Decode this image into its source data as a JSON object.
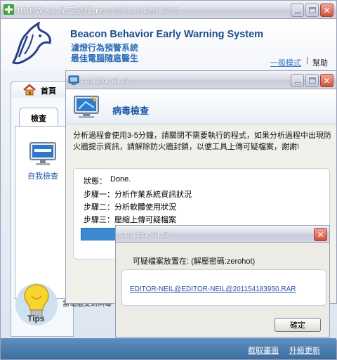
{
  "main_window": {
    "title": "BBEW v1.5 正式版 rev: 201104251625",
    "app_name": "Beacon Behavior Early Warning System",
    "slogan_line1": "濾燈行為預警系統",
    "slogan_line2": "最佳電腦隨扈醫生",
    "mode_link": "一般模式",
    "separator": "|",
    "help_link": "幫助",
    "home_tab": "首頁",
    "check_tab": "檢查",
    "self_check_label": "自我檢查",
    "tips_label": "Tips",
    "tips_text": "當電腦受到病毒",
    "footer_links": [
      "截取畫面",
      "升級更新"
    ]
  },
  "amea_window": {
    "title": "AMEA v1.5",
    "heading": "病毒檢查",
    "description": "分析過程會使用3-5分鐘，請關閉不需要執行的程式，如果分析過程中出現防火牆提示資訊，請解除防火牆封鎖，以便工具上傳可疑檔案，謝謝!",
    "status_label": "狀態：",
    "status_value": "Done.",
    "steps": [
      "步驟一：分析作業系統資訊狀況",
      "步驟二：分析軟體使用狀況",
      "步驟三：壓縮上傳可疑檔案"
    ]
  },
  "dialog": {
    "title": "AMEA v1.5",
    "message": "可疑檔案放置在: (解壓密碼:zerohot)",
    "file_path": "EDITOR-NEIL@EDITOR-NEIL@201154183950.RAR",
    "ok_button": "確定"
  },
  "colors": {
    "link_blue": "#2b4fa8",
    "heading_blue": "#1b55a6",
    "footer_blue": "#4a7aad",
    "progress_blue": "#3b89d0"
  },
  "icons": [
    "app-cross-icon",
    "wolf-logo-icon",
    "home-icon",
    "monitor-icon",
    "lightbulb-icon",
    "scan-monitor-icon",
    "minimize-icon",
    "maximize-icon",
    "close-icon"
  ]
}
